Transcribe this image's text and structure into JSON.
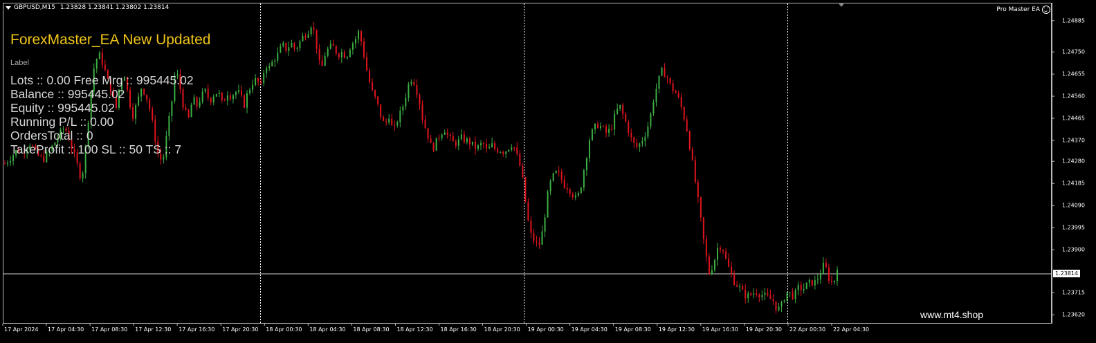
{
  "header": {
    "symbol": "GBPUSD,M15",
    "ohlc": "1.23828 1.23841 1.23802 1.23814"
  },
  "ea_badge": "Pro Master EA",
  "panel": {
    "title": "ForexMaster_EA New Updated",
    "label": "Label",
    "lines": [
      "Lots :: 0.00 Free Mrg :: 995445.02",
      "Balance :: 995445.02",
      "Equity :: 995445.02",
      "Running P/L :: 0.00",
      "OrdersTotal :: 0",
      "TakeProfit :: 100 SL :: 50 TS :: 7"
    ]
  },
  "watermark": "www.mt4.shop",
  "current_price": "1.23814",
  "price_axis": [
    "1.24885",
    "1.24750",
    "1.24655",
    "1.24560",
    "1.24465",
    "1.24370",
    "1.24280",
    "1.24185",
    "1.24090",
    "1.23995",
    "1.23900",
    "1.23715",
    "1.23620"
  ],
  "time_axis": [
    "17 Apr 2024",
    "17 Apr 04:30",
    "17 Apr 08:30",
    "17 Apr 12:30",
    "17 Apr 16:30",
    "17 Apr 20:30",
    "18 Apr 00:30",
    "18 Apr 04:30",
    "18 Apr 08:30",
    "18 Apr 12:30",
    "18 Apr 16:30",
    "18 Apr 20:30",
    "19 Apr 00:30",
    "19 Apr 04:30",
    "19 Apr 08:30",
    "19 Apr 12:30",
    "19 Apr 16:30",
    "19 Apr 20:30",
    "22 Apr 00:30",
    "22 Apr 04:30"
  ],
  "colors": {
    "background": "#000000",
    "bull": "#3cb043",
    "bear": "#e0141e",
    "grid": "#ffffff",
    "title": "#f0c419"
  },
  "chart_data": {
    "type": "candlestick",
    "symbol": "GBPUSD",
    "timeframe": "M15",
    "ylim": [
      1.236,
      1.2492
    ],
    "current": 1.23814,
    "close_path": [
      1.2427,
      1.2429,
      1.2431,
      1.2433,
      1.2432,
      1.2434,
      1.2436,
      1.2432,
      1.243,
      1.2429,
      1.2431,
      1.2434,
      1.2437,
      1.244,
      1.2443,
      1.2438,
      1.2432,
      1.2426,
      1.242,
      1.2435,
      1.2455,
      1.247,
      1.2474,
      1.247,
      1.2463,
      1.2458,
      1.245,
      1.2462,
      1.2466,
      1.2455,
      1.2448,
      1.2453,
      1.246,
      1.2457,
      1.245,
      1.244,
      1.243,
      1.2428,
      1.244,
      1.2452,
      1.2468,
      1.246,
      1.245,
      1.2446,
      1.2455,
      1.2452,
      1.2456,
      1.2458,
      1.2454,
      1.2457,
      1.2458,
      1.2452,
      1.2458,
      1.2456,
      1.2458,
      1.2457,
      1.2452,
      1.2458,
      1.2462,
      1.2463,
      1.246,
      1.247,
      1.2468,
      1.2472,
      1.2474,
      1.2478,
      1.2476,
      1.2479,
      1.2476,
      1.2479,
      1.2482,
      1.2484,
      1.2488,
      1.2478,
      1.2466,
      1.2474,
      1.2477,
      1.2477,
      1.2474,
      1.2475,
      1.2473,
      1.2478,
      1.248,
      1.2484,
      1.2475,
      1.2465,
      1.2458,
      1.2454,
      1.2448,
      1.2443,
      1.2448,
      1.244,
      1.2446,
      1.245,
      1.2457,
      1.2464,
      1.2462,
      1.2455,
      1.2445,
      1.244,
      1.2433,
      1.2436,
      1.244,
      1.2442,
      1.2438,
      1.2436,
      1.2436,
      1.2438,
      1.2437,
      1.2436,
      1.2434,
      1.2434,
      1.2436,
      1.2432,
      1.2435,
      1.2433,
      1.2433,
      1.2432,
      1.2434,
      1.2436,
      1.243,
      1.2424,
      1.241,
      1.2397,
      1.2394,
      1.2391,
      1.2398,
      1.2412,
      1.242,
      1.2423,
      1.2422,
      1.2418,
      1.2417,
      1.2414,
      1.2411,
      1.2418,
      1.2428,
      1.2438,
      1.2442,
      1.2444,
      1.2442,
      1.244,
      1.2442,
      1.2448,
      1.2452,
      1.2447,
      1.2442,
      1.2436,
      1.2434,
      1.2436,
      1.244,
      1.2445,
      1.2455,
      1.2462,
      1.2467,
      1.2465,
      1.246,
      1.2458,
      1.2454,
      1.2448,
      1.244,
      1.2428,
      1.2416,
      1.2403,
      1.239,
      1.238,
      1.2384,
      1.2391,
      1.2392,
      1.2385,
      1.238,
      1.2376,
      1.2374,
      1.2371,
      1.237,
      1.2371,
      1.2372,
      1.2371,
      1.237,
      1.2369,
      1.2368,
      1.2364,
      1.2366,
      1.2372,
      1.2371,
      1.237,
      1.2374,
      1.2373,
      1.2375,
      1.2376,
      1.2376,
      1.238,
      1.2384,
      1.2378,
      1.2375,
      1.2381
    ]
  }
}
